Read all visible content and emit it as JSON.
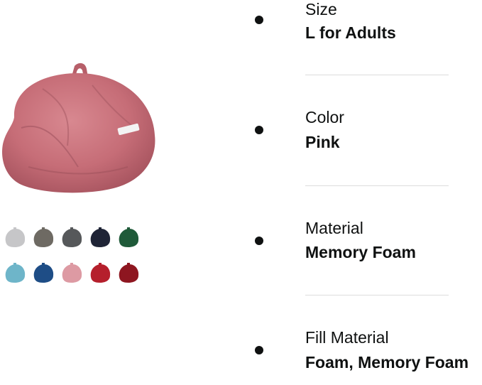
{
  "product": {
    "image_icon": "bean-bag-chair-pink",
    "color_swatches": [
      {
        "name": "light-gray",
        "color": "#c6c6c8"
      },
      {
        "name": "warm-gray",
        "color": "#6e6a63"
      },
      {
        "name": "charcoal",
        "color": "#56585a"
      },
      {
        "name": "navy",
        "color": "#1f2436"
      },
      {
        "name": "forest-green",
        "color": "#1f5a39"
      },
      {
        "name": "sky-blue",
        "color": "#6eb5c9"
      },
      {
        "name": "royal-blue",
        "color": "#1e4d86"
      },
      {
        "name": "pink",
        "color": "#dd9aa3"
      },
      {
        "name": "red",
        "color": "#b51f2c"
      },
      {
        "name": "burgundy",
        "color": "#8e1620"
      }
    ]
  },
  "specs": [
    {
      "label": "Size",
      "value": "L for Adults"
    },
    {
      "label": "Color",
      "value": "Pink"
    },
    {
      "label": "Material",
      "value": "Memory Foam"
    },
    {
      "label": "Fill Material",
      "value": "Foam, Memory Foam"
    }
  ],
  "colors": {
    "text": "#0f1111",
    "divider": "#dddddd",
    "product_pink": "#c96e78"
  }
}
